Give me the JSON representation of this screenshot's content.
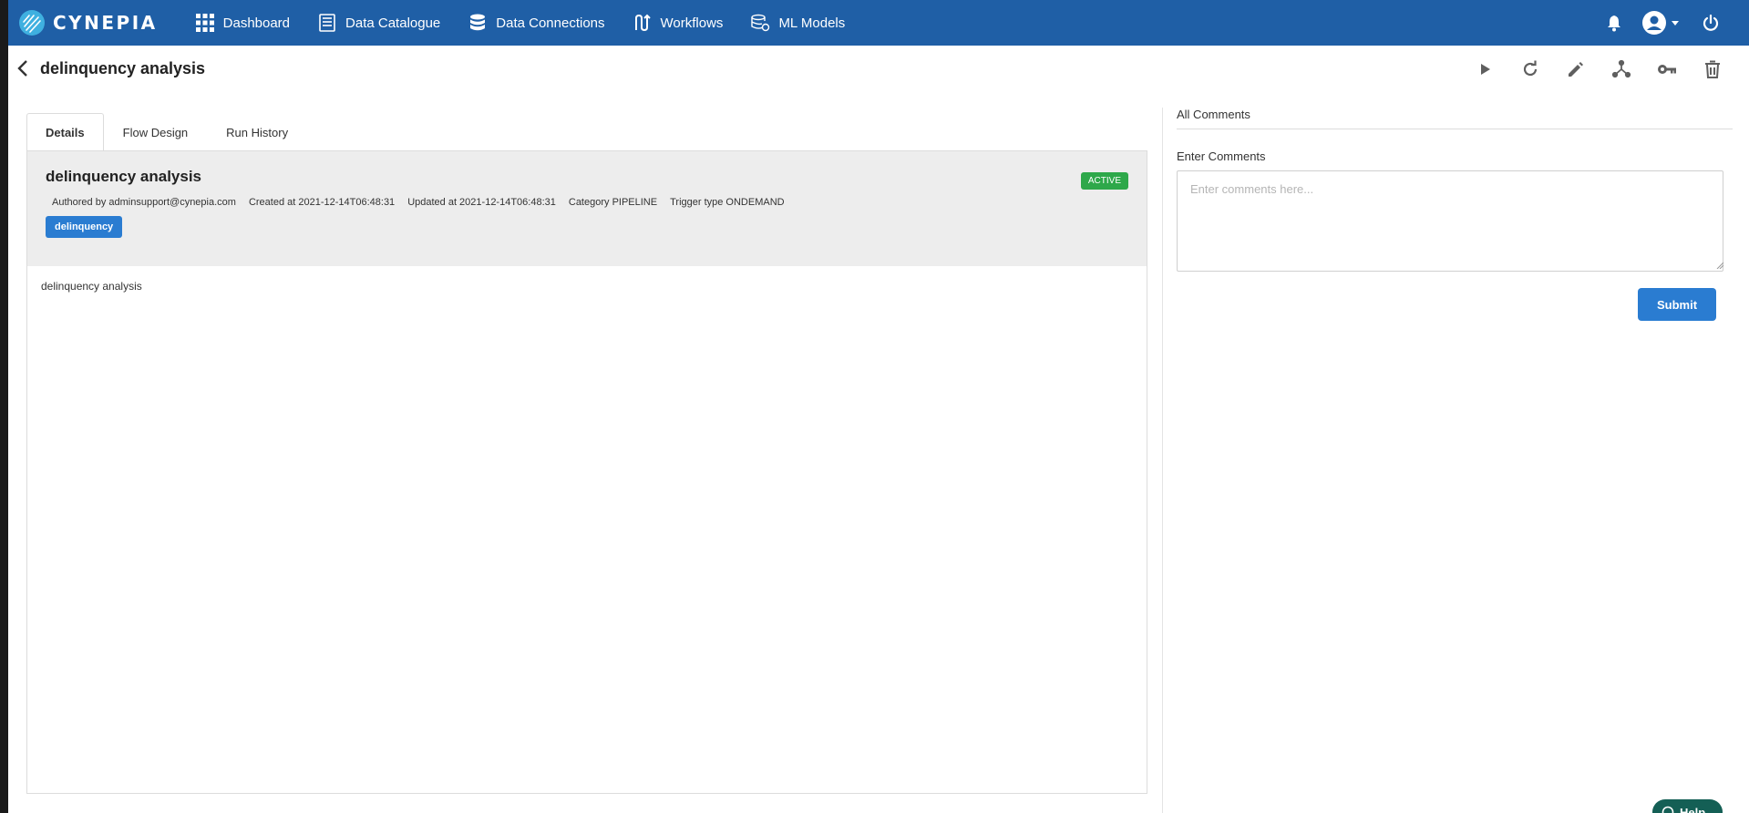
{
  "brand": {
    "name": "CYNEPIA"
  },
  "nav": {
    "items": [
      {
        "label": "Dashboard",
        "icon": "grid-icon"
      },
      {
        "label": "Data Catalogue",
        "icon": "document-icon"
      },
      {
        "label": "Data Connections",
        "icon": "database-icon"
      },
      {
        "label": "Workflows",
        "icon": "workflow-icon"
      },
      {
        "label": "ML Models",
        "icon": "ml-model-icon"
      }
    ],
    "right_icons": [
      "bell-icon",
      "account-icon",
      "power-icon"
    ]
  },
  "header": {
    "title": "delinquency analysis",
    "actions": [
      "play-icon",
      "refresh-icon",
      "edit-icon",
      "fork-icon",
      "key-icon",
      "delete-icon"
    ]
  },
  "tabs": [
    {
      "label": "Details",
      "active": true
    },
    {
      "label": "Flow Design",
      "active": false
    },
    {
      "label": "Run History",
      "active": false
    }
  ],
  "details": {
    "title": "delinquency analysis",
    "status": "ACTIVE",
    "meta": {
      "author": "Authored by adminsupport@cynepia.com",
      "created": "Created at 2021-12-14T06:48:31",
      "updated": "Updated at 2021-12-14T06:48:31",
      "category": "Category PIPELINE",
      "trigger": "Trigger type ONDEMAND"
    },
    "tag": "delinquency",
    "description": "delinquency analysis"
  },
  "comments": {
    "title": "All Comments",
    "label": "Enter Comments",
    "placeholder": "Enter comments here...",
    "submit_label": "Submit"
  },
  "help": {
    "label": "Help"
  },
  "colors": {
    "nav_bg": "#1f5fa6",
    "accent": "#2a7cd1",
    "status_active": "#2ea84a",
    "help_bg": "#145f55"
  }
}
